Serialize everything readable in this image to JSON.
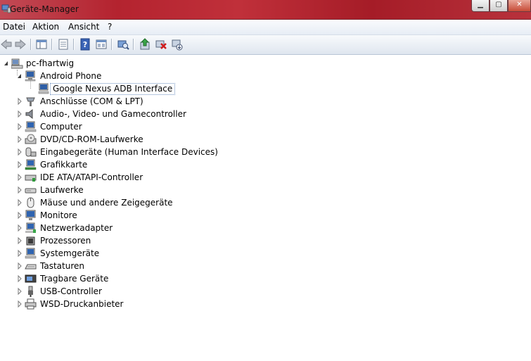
{
  "window": {
    "title": "Geräte-Manager",
    "minimize_glyph": "▁",
    "maximize_glyph": "▢",
    "close_glyph": "✕"
  },
  "menu": [
    "Datei",
    "Aktion",
    "Ansicht",
    "?"
  ],
  "toolbar": {
    "icons": [
      "back-arrow-icon",
      "forward-arrow-icon",
      "show-hide-tree-icon",
      "properties-icon",
      "help-icon",
      "view-icon",
      "scan-hardware-icon",
      "update-driver-icon",
      "disable-device-icon",
      "uninstall-device-icon"
    ]
  },
  "tree": {
    "root": "pc-fhartwig",
    "expanded_category": "Android Phone",
    "selected_device": "Google Nexus ADB Interface",
    "categories": [
      "Anschlüsse (COM & LPT)",
      "Audio-, Video- und Gamecontroller",
      "Computer",
      "DVD/CD-ROM-Laufwerke",
      "Eingabegeräte (Human Interface Devices)",
      "Grafikkarte",
      "IDE ATA/ATAPI-Controller",
      "Laufwerke",
      "Mäuse und andere Zeigegeräte",
      "Monitore",
      "Netzwerkadapter",
      "Prozessoren",
      "Systemgeräte",
      "Tastaturen",
      "Tragbare Geräte",
      "USB-Controller",
      "WSD-Druckanbieter"
    ],
    "category_icons": [
      "port-icon",
      "speaker-icon",
      "computer-icon",
      "dvd-drive-icon",
      "hid-icon",
      "display-adapter-icon",
      "ide-controller-icon",
      "disk-drive-icon",
      "mouse-icon",
      "monitor-icon",
      "network-adapter-icon",
      "processor-icon",
      "system-device-icon",
      "keyboard-icon",
      "portable-device-icon",
      "usb-icon",
      "printer-icon"
    ]
  }
}
